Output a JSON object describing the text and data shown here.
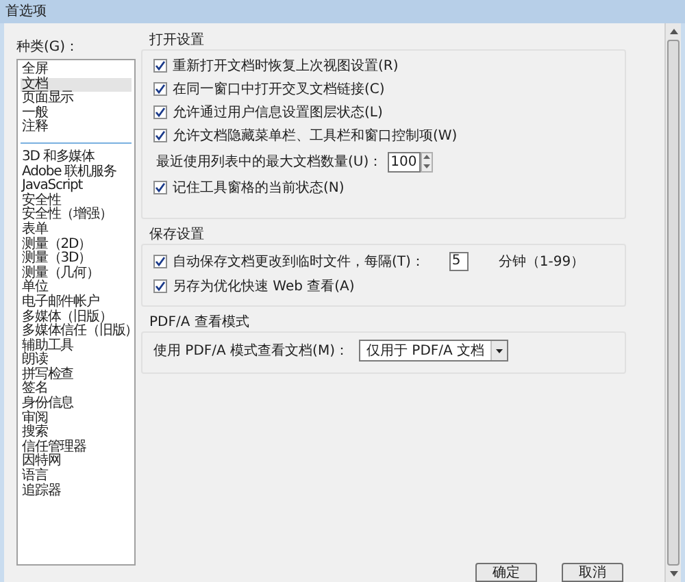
{
  "window": {
    "title": "首选项"
  },
  "categories": {
    "label": "种类(G)：",
    "groups": [
      [
        {
          "label": "全屏",
          "selected": false
        },
        {
          "label": "文档",
          "selected": true
        },
        {
          "label": "页面显示",
          "selected": false
        },
        {
          "label": "一般",
          "selected": false
        },
        {
          "label": "注释",
          "selected": false
        }
      ],
      [
        {
          "label": "3D 和多媒体",
          "selected": false
        },
        {
          "label": "Adobe 联机服务",
          "selected": false
        },
        {
          "label": "JavaScript",
          "selected": false
        },
        {
          "label": "安全性",
          "selected": false
        },
        {
          "label": "安全性（增强）",
          "selected": false
        },
        {
          "label": "表单",
          "selected": false
        },
        {
          "label": "测量（2D）",
          "selected": false
        },
        {
          "label": "测量（3D）",
          "selected": false
        },
        {
          "label": "测量（几何）",
          "selected": false
        },
        {
          "label": "单位",
          "selected": false
        },
        {
          "label": "电子邮件帐户",
          "selected": false
        },
        {
          "label": "多媒体（旧版）",
          "selected": false
        },
        {
          "label": "多媒体信任（旧版）",
          "selected": false
        },
        {
          "label": "辅助工具",
          "selected": false
        },
        {
          "label": "朗读",
          "selected": false
        },
        {
          "label": "拼写检查",
          "selected": false
        },
        {
          "label": "签名",
          "selected": false
        },
        {
          "label": "身份信息",
          "selected": false
        },
        {
          "label": "审阅",
          "selected": false
        },
        {
          "label": "搜索",
          "selected": false
        },
        {
          "label": "信任管理器",
          "selected": false
        },
        {
          "label": "因特网",
          "selected": false
        },
        {
          "label": "语言",
          "selected": false
        },
        {
          "label": "追踪器",
          "selected": false
        }
      ]
    ]
  },
  "sections": [
    {
      "title": "打开设置",
      "rows": [
        {
          "kind": "checkbox",
          "label": "重新打开文档时恢复上次视图设置(R)",
          "checked": true
        },
        {
          "kind": "checkbox",
          "label": "在同一窗口中打开交叉文档链接(C)",
          "checked": true
        },
        {
          "kind": "checkbox",
          "label": "允许通过用户信息设置图层状态(L)",
          "checked": true
        },
        {
          "kind": "checkbox",
          "label": "允许文档隐藏菜单栏、工具栏和窗口控制项(W)",
          "checked": true
        },
        {
          "kind": "spinner",
          "label": "最近使用列表中的最大文档数量(U)：",
          "value": "100"
        },
        {
          "kind": "checkbox",
          "label": "记住工具窗格的当前状态(N)",
          "checked": true
        }
      ]
    },
    {
      "title": "保存设置",
      "rows": [
        {
          "kind": "checkbox-field",
          "label": "自动保存文档更改到临时文件，每隔(T)：",
          "checked": true,
          "value": "5",
          "suffix": "分钟（1-99）"
        },
        {
          "kind": "checkbox",
          "label": "另存为优化快速 Web 查看(A)",
          "checked": true
        }
      ]
    },
    {
      "title": "PDF/A 查看模式",
      "rows": [
        {
          "kind": "dropdown",
          "label": "使用 PDF/A 模式查看文档(M)：",
          "value": "仅用于 PDF/A 文档"
        }
      ]
    }
  ],
  "buttons": [
    "确定",
    "取消"
  ]
}
